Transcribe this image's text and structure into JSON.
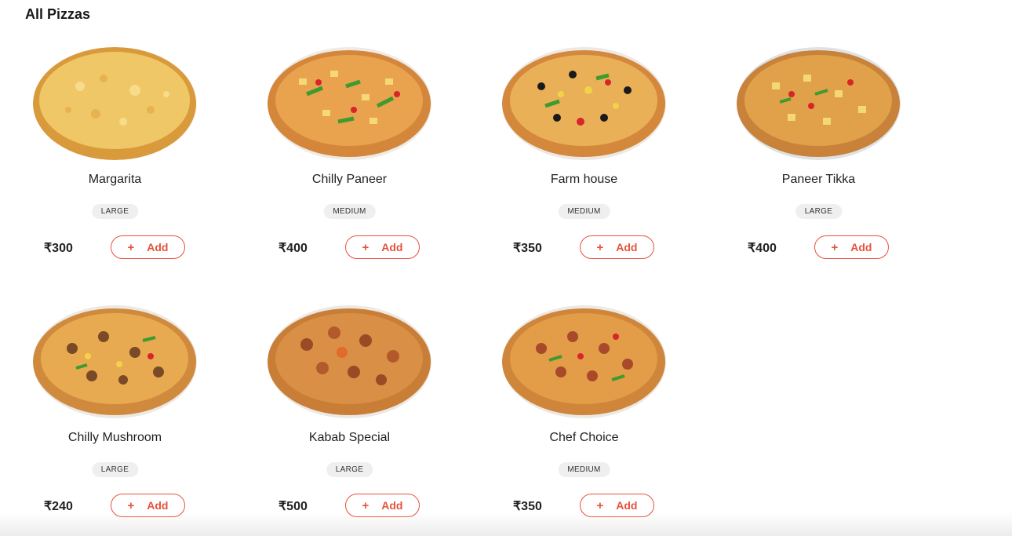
{
  "section": {
    "title": "All Pizzas"
  },
  "currency_symbol": "₹",
  "accent_color": "#e5533a",
  "products": [
    {
      "name": "Margarita",
      "size": "LARGE",
      "price": "₹300",
      "add_label": "Add",
      "add_icon": "+",
      "image": "margarita-pizza"
    },
    {
      "name": "Chilly Paneer",
      "size": "MEDIUM",
      "price": "₹400",
      "add_label": "Add",
      "add_icon": "+",
      "image": "chilly-paneer-pizza"
    },
    {
      "name": "Farm house",
      "size": "MEDIUM",
      "price": "₹350",
      "add_label": "Add",
      "add_icon": "+",
      "image": "farm-house-pizza"
    },
    {
      "name": "Paneer Tikka",
      "size": "LARGE",
      "price": "₹400",
      "add_label": "Add",
      "add_icon": "+",
      "image": "paneer-tikka-pizza"
    },
    {
      "name": "Chilly Mushroom",
      "size": "LARGE",
      "price": "₹240",
      "add_label": "Add",
      "add_icon": "+",
      "image": "chilly-mushroom-pizza"
    },
    {
      "name": "Kabab Special",
      "size": "LARGE",
      "price": "₹500",
      "add_label": "Add",
      "add_icon": "+",
      "image": "kabab-special-pizza"
    },
    {
      "name": "Chef Choice",
      "size": "MEDIUM",
      "price": "₹350",
      "add_label": "Add",
      "add_icon": "+",
      "image": "chef-choice-pizza"
    }
  ]
}
